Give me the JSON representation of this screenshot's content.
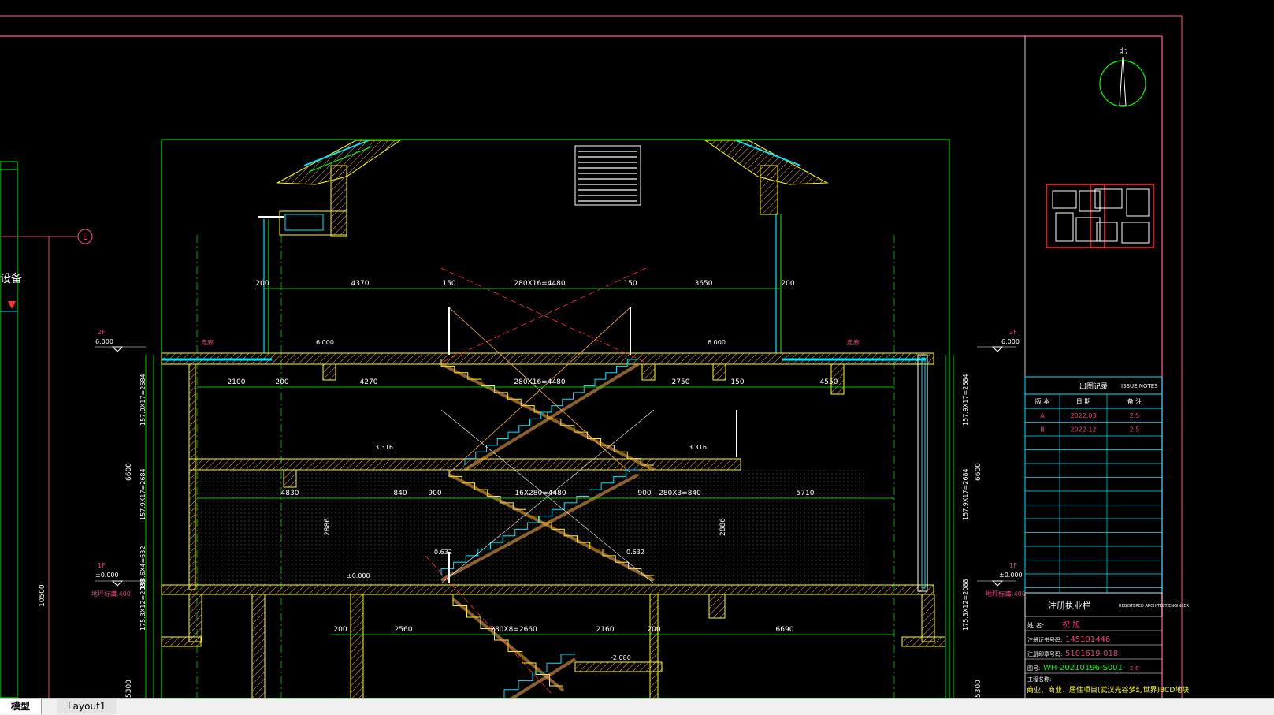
{
  "colors": {
    "background": "#000000",
    "frame": "#e0447a",
    "green": "#00ff00",
    "yellow": "#ffff00",
    "cyan": "#00e5ff",
    "orange": "#ffb050",
    "red": "#ff3030",
    "white": "#ffffff"
  },
  "tabs": [
    {
      "label": "模型"
    },
    {
      "label": "Layout1"
    }
  ],
  "drawing": {
    "grid_axis": "L",
    "left_label": "设备",
    "level_2f": "2F",
    "level_2f_value": "6.000",
    "level_1f": "1F",
    "level_1f_value": "±0.000",
    "floor_tag": "地坪标高",
    "floor_value": "-0.400",
    "corridor": "走廊",
    "mid_level": "3.316",
    "mid_level2": "0.632",
    "basement_level": "-2.080",
    "dims_top": [
      "200",
      "4370",
      "150",
      "280X16=4480",
      "150",
      "3650",
      "200"
    ],
    "dims_upper": [
      "2100",
      "200",
      "4270",
      "280X16=4480",
      "2750",
      "150",
      "4550"
    ],
    "dims_middle": [
      "4830",
      "840",
      "900",
      "16X280=4480",
      "900",
      "280X3=840",
      "5710"
    ],
    "dims_lower": [
      "200",
      "2560",
      "280X8=2660",
      "2160",
      "200",
      "6690"
    ],
    "vertical_dims": [
      "6600",
      "2886",
      "2886",
      "10500",
      "5300"
    ],
    "stair_note_a": "157.9X17=2684",
    "stair_note_b": "175.3X12=2088",
    "stair_note_c": "158.6X4=632"
  },
  "title_block": {
    "north": "北",
    "issue_title": "出图记录",
    "issue_title_en": "ISSUE NOTES",
    "columns": [
      "版 本",
      "日 期",
      "备 注"
    ],
    "rows": [
      {
        "ver": "A",
        "date": "2022.03",
        "note": "2.5"
      },
      {
        "ver": "B",
        "date": "2022.12",
        "note": "2.5"
      }
    ],
    "stamp_title": "注册执业栏",
    "stamp_title_en": "REGISTERED ARCHITECT/ENGINEER",
    "name_label": "姓  名:",
    "name_value": "祝 旭",
    "cert_label": "注册证书号码:",
    "cert_value": "145101446",
    "seal_label": "注册印章号码:",
    "seal_value": "5101619-018",
    "drawing_no_label": "图号:",
    "drawing_no": "WH-20210196-S001-",
    "drawing_no_suffix": "2-6",
    "project_label": "工程名称:",
    "project_name": "商业、商业、居住项目(武汉光谷梦幻世界)BCD地块"
  }
}
